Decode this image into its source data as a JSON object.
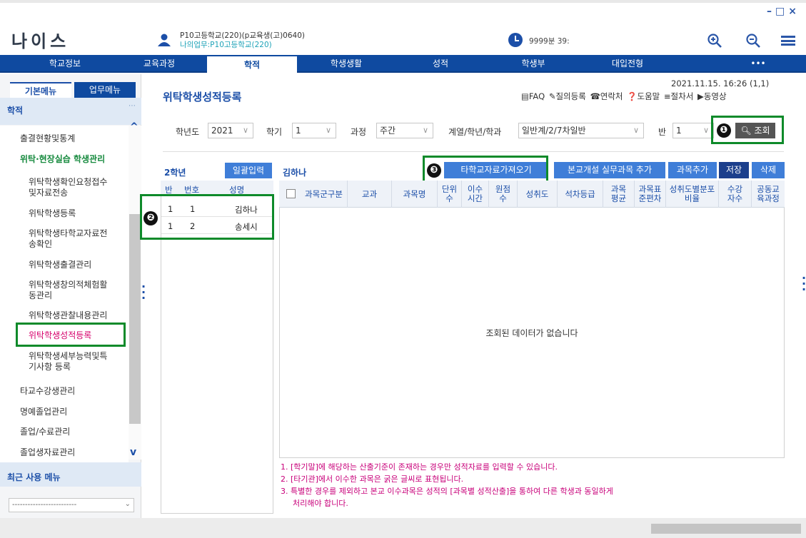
{
  "window": {
    "controls": "–□×"
  },
  "app": {
    "logo": "나이스"
  },
  "user": {
    "line1": "P10고등학교(220)(p교육생(고)0640)",
    "line2": "나의업무:P10고등학교(220)"
  },
  "session": {
    "timer": "9999분 39:"
  },
  "icons": {
    "user": "user-icon",
    "clock": "clock-icon",
    "zoom_in": "zoom-in-icon",
    "zoom_out": "zoom-out-icon",
    "menu": "hamburger-menu-icon",
    "search": "search-icon"
  },
  "nav": {
    "items": [
      "학교정보",
      "교육과정",
      "학적",
      "학생생활",
      "성적",
      "학생부",
      "대입전형",
      "•••"
    ],
    "active_index": 2
  },
  "sidebar": {
    "tabs": {
      "basic": "기본메뉴",
      "work": "업무메뉴"
    },
    "section": "학적",
    "dots": "⋯",
    "items": [
      {
        "label": "출결현황및통계",
        "level": 1
      },
      {
        "label": "위탁·현장실습 학생관리",
        "level": 1
      },
      {
        "label": "위탁학생확인요청접수\n및자료전송",
        "level": 2
      },
      {
        "label": "위탁학생등록",
        "level": 2
      },
      {
        "label": "위탁학생타학교자료전\n송확인",
        "level": 2
      },
      {
        "label": "위탁학생출결관리",
        "level": 2
      },
      {
        "label": "위탁학생창의적체험활\n동관리",
        "level": 2
      },
      {
        "label": "위탁학생관찰내용관리",
        "level": 2
      },
      {
        "label": "위탁학생성적등록",
        "level": 2
      },
      {
        "label": "위탁학생세부능력및특\n기사항 등록",
        "level": 2
      },
      {
        "label": "타교수강생관리",
        "level": 1
      },
      {
        "label": "명예졸업관리",
        "level": 1
      },
      {
        "label": "졸업/수료관리",
        "level": 1
      },
      {
        "label": "졸업생자료관리",
        "level": 1
      }
    ],
    "recent_label": "최근 사용 메뉴",
    "recent_select": "-------------------------"
  },
  "page": {
    "title": "위탁학생성적등록",
    "datetime": "2021.11.15. 16:26 (1,1)",
    "links": [
      "FAQ",
      "질의등록",
      "연락처",
      "도움말",
      "절차서",
      "동영상"
    ]
  },
  "filters": {
    "year_label": "학년도",
    "year_value": "2021",
    "term_label": "학기",
    "term_value": "1",
    "course_label": "과정",
    "course_value": "주간",
    "dept_label": "계열/학년/학과",
    "dept_value": "일반계/2/7차일반",
    "class_label": "반",
    "class_value": "1",
    "search_button": "조회"
  },
  "annotations": {
    "n1": "❶",
    "n2": "❷",
    "n3": "❸"
  },
  "student_panel": {
    "grade": "2학년",
    "bulk_button": "일괄입력",
    "headers": [
      "반",
      "번호",
      "성명"
    ],
    "rows": [
      [
        "1",
        "1",
        "김하나"
      ],
      [
        "1",
        "2",
        "송세시"
      ]
    ]
  },
  "grid": {
    "student_name": "김하나",
    "buttons": {
      "fetch": "타학교자료가져오기",
      "add_practice": "본교개설 실무과목 추가",
      "add_subject": "과목추가",
      "save": "저장",
      "delete": "삭제"
    },
    "headers": [
      "과목군구분",
      "교과",
      "과목명",
      "단위수",
      "이수시간",
      "원점수",
      "성취도",
      "석차등급",
      "과목평균",
      "과목표준편차",
      "성취도별분포비율",
      "수강자수",
      "공동교육과정"
    ],
    "empty_message": "조회된 데이터가 없습니다"
  },
  "notes": [
    "1. [학기말]에 해당하는 산출기준이 존재하는 경우만 성적자료를 입력할 수 있습니다.",
    "2. [타기관]에서 이수한 과목은 굵은 글씨로 표현됩니다.",
    "3. 특별한 경우를 제외하고 본교 이수과목은 성적의 [과목별 성적산출]을 통하여 다른 학생과 동일하게",
    "처리해야 합니다."
  ]
}
